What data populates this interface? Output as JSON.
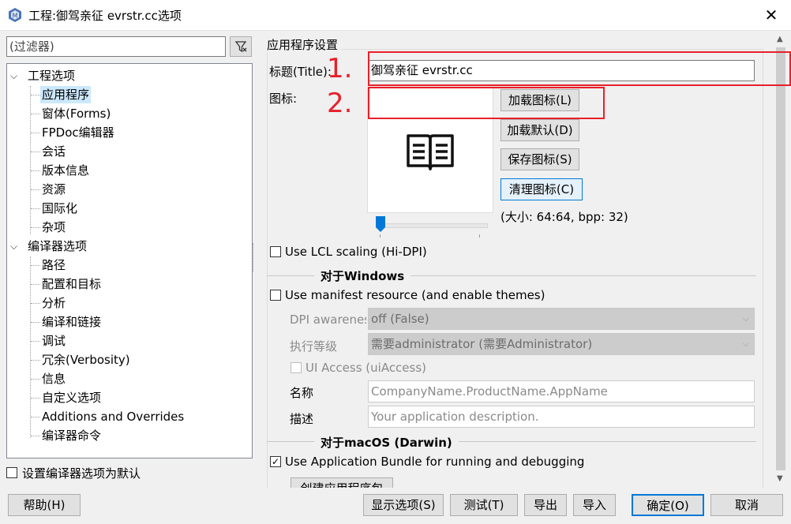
{
  "window": {
    "title": "工程:御驾亲征 evrstr.cc选项",
    "close": "✕"
  },
  "filter": {
    "placeholder": "(过滤器)"
  },
  "tree": {
    "items": [
      {
        "label": "工程选项"
      },
      {
        "label": "应用程序"
      },
      {
        "label": "窗体(Forms)"
      },
      {
        "label": "FPDoc编辑器"
      },
      {
        "label": "会话"
      },
      {
        "label": "版本信息"
      },
      {
        "label": "资源"
      },
      {
        "label": "国际化"
      },
      {
        "label": "杂项"
      },
      {
        "label": "编译器选项"
      },
      {
        "label": "路径"
      },
      {
        "label": "配置和目标"
      },
      {
        "label": "分析"
      },
      {
        "label": "编译和链接"
      },
      {
        "label": "调试"
      },
      {
        "label": "冗余(Verbosity)"
      },
      {
        "label": "信息"
      },
      {
        "label": "自定义选项"
      },
      {
        "label": "Additions and Overrides"
      },
      {
        "label": "编译器命令"
      }
    ]
  },
  "set_default_checkbox": {
    "label": "设置编译器选项为默认",
    "checked": false
  },
  "app_settings": {
    "group_title": "应用程序设置",
    "title_label": "标题(Title):",
    "title_value": "御驾亲征 evrstr.cc",
    "icon_label": "图标:",
    "load_icon": "加载图标(L)",
    "load_default": "加载默认(D)",
    "save_icon": "保存图标(S)",
    "clear_icon": "清理图标(C)",
    "size_info": "(大小: 64:64, bpp: 32)",
    "use_lcl_scaling": {
      "label": "Use LCL scaling (Hi-DPI)",
      "checked": false
    }
  },
  "windows": {
    "section_title": "对于Windows",
    "use_manifest": {
      "label": "Use manifest resource (and enable themes)",
      "checked": false
    },
    "dpi_label": "DPI awarenes",
    "dpi_value": "off (False)",
    "exec_level_label": "执行等级",
    "exec_level_value": "需要administrator (需要Administrator)",
    "ui_access": {
      "label": "UI Access (uiAccess)",
      "checked": false
    },
    "name_label": "名称",
    "name_placeholder": "CompanyName.ProductName.AppName",
    "desc_label": "描述",
    "desc_placeholder": "Your application description."
  },
  "macos": {
    "section_title": "对于macOS (Darwin)",
    "use_bundle": {
      "label": "Use Application Bundle for running and debugging",
      "checked": true
    },
    "create_bundle_partial": "创建应用程序包"
  },
  "annotations": {
    "one": "1.",
    "two": "2."
  },
  "bottom": {
    "help": "帮助(H)",
    "show_options": "显示选项(S)",
    "test": "测试(T)",
    "export": "导出",
    "import": "导入",
    "ok": "确定(O)",
    "cancel": "取消"
  },
  "colors": {
    "annotation_red": "#e8202a",
    "selection": "#cce8ff",
    "focus_blue": "#0078d7"
  }
}
